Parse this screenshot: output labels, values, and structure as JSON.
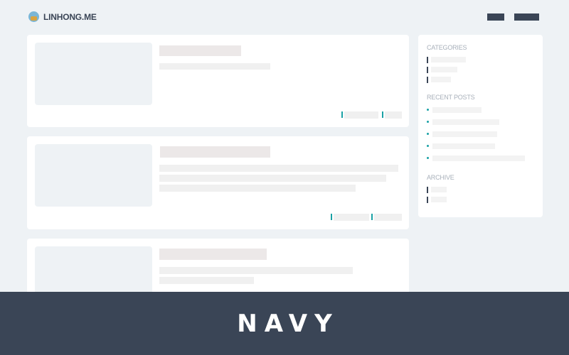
{
  "header": {
    "site_name": "LINHONG.ME",
    "logo_icon": "avatar-icon",
    "nav_items": [
      {
        "label": ""
      },
      {
        "label": ""
      }
    ]
  },
  "sidebar": {
    "categories_heading": "CATEGORIES",
    "recent_posts_heading": "RECENT POSTS",
    "archive_heading": "ARCHIVE"
  },
  "banner": {
    "title": "NAVY"
  },
  "colors": {
    "background": "#eef2f5",
    "card": "#ffffff",
    "navy": "#3a4556",
    "accent_teal": "#1aa1a5",
    "placeholder": "#f0f0f0"
  }
}
